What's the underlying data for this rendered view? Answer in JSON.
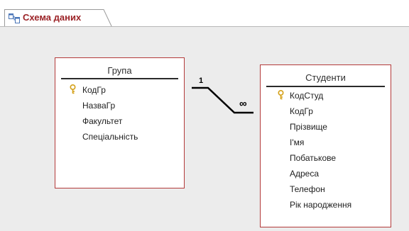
{
  "tab": {
    "label": "Схема даних",
    "icon": "relationships-icon"
  },
  "tables": {
    "grupa": {
      "title": "Група",
      "fields": [
        {
          "name": "КодГр",
          "primary_key": true
        },
        {
          "name": "НазваГр",
          "primary_key": false
        },
        {
          "name": "Факультет",
          "primary_key": false
        },
        {
          "name": "Спеціальність",
          "primary_key": false
        }
      ]
    },
    "studenty": {
      "title": "Студенти",
      "fields": [
        {
          "name": "КодСтуд",
          "primary_key": true
        },
        {
          "name": "КодГр",
          "primary_key": false
        },
        {
          "name": "Прізвище",
          "primary_key": false
        },
        {
          "name": "І'мя",
          "primary_key": false
        },
        {
          "name": "Побатькове",
          "primary_key": false
        },
        {
          "name": "Адреса",
          "primary_key": false
        },
        {
          "name": "Телефон",
          "primary_key": false
        },
        {
          "name": "Рік народження",
          "primary_key": false
        }
      ]
    }
  },
  "relationship": {
    "one_label": "1",
    "many_label": "∞"
  },
  "colors": {
    "accent": "#9b2226",
    "table_border": "#b33a3a",
    "canvas": "#ececec",
    "key_icon": "#d4a017"
  }
}
